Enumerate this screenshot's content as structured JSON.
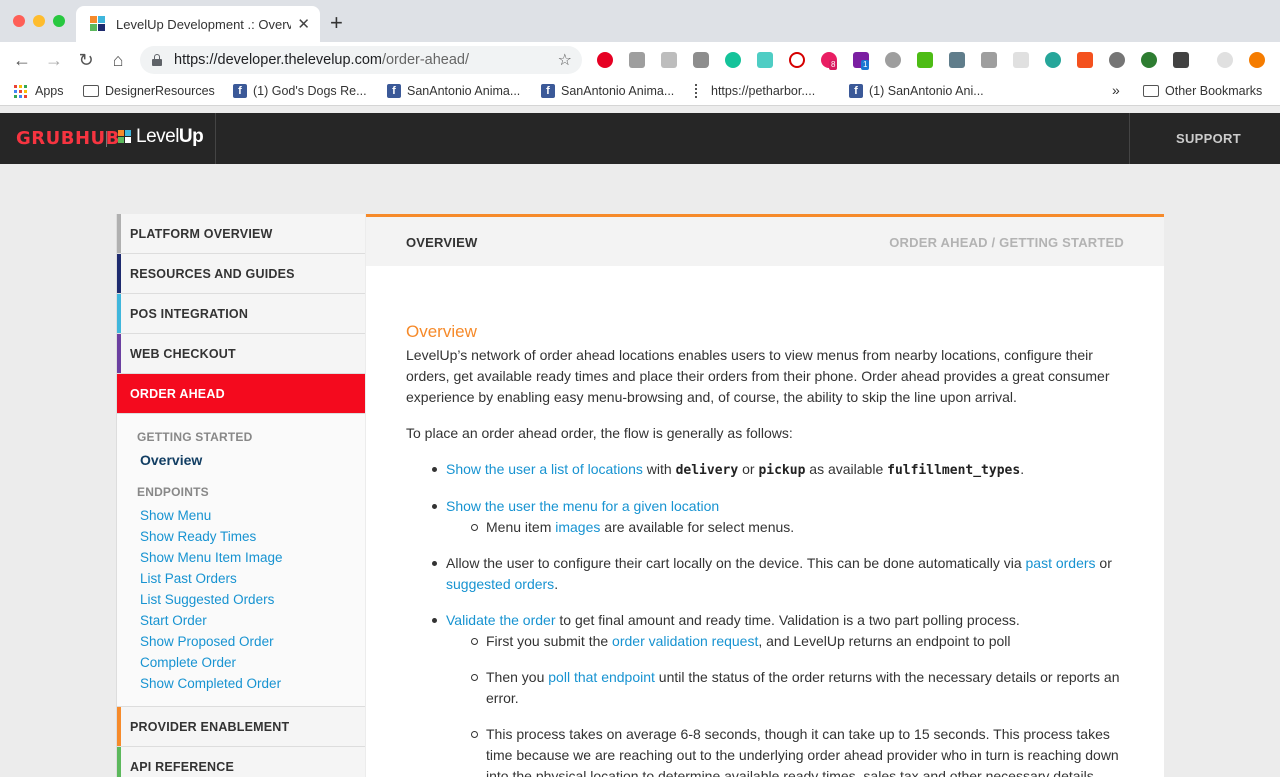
{
  "browser": {
    "tab_title": "LevelUp Development .: Overvi",
    "url_host": "https://developer.thelevelup.com",
    "url_path": "/order-ahead/",
    "bookmarks": [
      {
        "label": "Apps",
        "icon": "apps-grid-icon"
      },
      {
        "label": "DesignerResources",
        "icon": "folder-icon"
      },
      {
        "label": "(1) God's Dogs Re...",
        "icon": "facebook-icon"
      },
      {
        "label": "SanAntonio Anima...",
        "icon": "facebook-icon"
      },
      {
        "label": "SanAntonio Anima...",
        "icon": "facebook-icon"
      },
      {
        "label": "https://petharbor....",
        "icon": "petharbor-icon"
      },
      {
        "label": "(1) SanAntonio Ani...",
        "icon": "facebook-icon"
      }
    ],
    "bookmarks_more": "»",
    "other_bookmarks": "Other Bookmarks",
    "ext_badges": {
      "m": "8",
      "p": "1"
    }
  },
  "header": {
    "brand": "GRUBHUB",
    "product_light": "Level",
    "product_bold": "Up",
    "support": "SUPPORT"
  },
  "sidebar": {
    "sections": [
      {
        "label": "PLATFORM OVERVIEW",
        "color": "#b0b0b0"
      },
      {
        "label": "RESOURCES AND GUIDES",
        "color": "#1d2a6e"
      },
      {
        "label": "POS INTEGRATION",
        "color": "#3fb6dc"
      },
      {
        "label": "WEB CHECKOUT",
        "color": "#6b3fa0"
      },
      {
        "label": "ORDER AHEAD",
        "color": "#f40a1e"
      }
    ],
    "getting_started_heading": "GETTING STARTED",
    "current_link": "Overview",
    "endpoints_heading": "ENDPOINTS",
    "endpoints": [
      "Show Menu",
      "Show Ready Times",
      "Show Menu Item Image",
      "List Past Orders",
      "List Suggested Orders",
      "Start Order",
      "Show Proposed Order",
      "Complete Order",
      "Show Completed Order"
    ],
    "after_sections": [
      {
        "label": "PROVIDER ENABLEMENT",
        "color": "#f68a2a"
      },
      {
        "label": "API REFERENCE",
        "color": "#5cb85c"
      }
    ]
  },
  "content": {
    "bar_title": "OVERVIEW",
    "breadcrumb": "ORDER AHEAD / GETTING STARTED",
    "heading": "Overview",
    "intro": "LevelUp’s network of order ahead locations enables users to view menus from nearby locations, configure their orders, get available ready times and place their orders from their phone. Order ahead provides a great consumer experience by enabling easy menu-browsing and, of course, the ability to skip the line upon arrival.",
    "flow_intro": "To place an order ahead order, the flow is generally as follows:",
    "step1": {
      "link": "Show the user a list of locations",
      "t1": " with ",
      "c1": "delivery",
      "t2": " or ",
      "c2": "pickup",
      "t3": " as available ",
      "c3": "fulfillment_types",
      "t4": "."
    },
    "step2": {
      "link": "Show the user the menu for a given location",
      "sub_t1": "Menu item ",
      "sub_link": "images",
      "sub_t2": " are available for select menus."
    },
    "step3": {
      "t1": "Allow the user to configure their cart locally on the device. This can be done automatically via ",
      "link1": "past orders",
      "t2": " or ",
      "link2": "suggested orders",
      "t3": "."
    },
    "step4": {
      "link": "Validate the order",
      "text": " to get final amount and ready time. Validation is a two part polling process.",
      "sub1_t1": "First you submit the ",
      "sub1_link": "order validation request",
      "sub1_t2": ", and LevelUp returns an endpoint to poll",
      "sub2_t1": "Then you ",
      "sub2_link": "poll that endpoint",
      "sub2_t2": " until the status of the order returns with the necessary details or reports an error.",
      "sub3": "This process takes on average 6-8 seconds, though it can take up to 15 seconds. This process takes time because we are reaching out to the underlying order ahead provider who in turn is reaching down into the physical location to determine available ready times, sales tax and other necessary details."
    }
  }
}
